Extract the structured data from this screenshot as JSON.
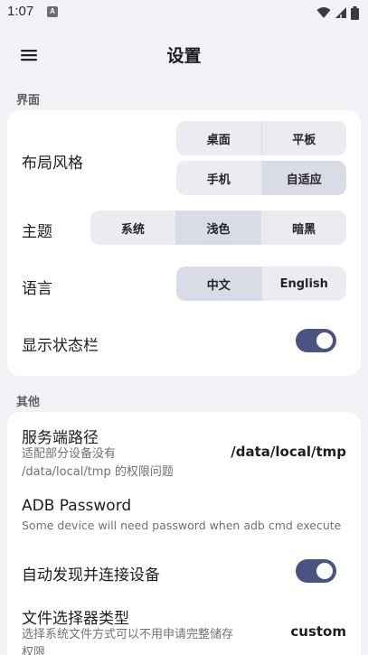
{
  "status_bar": {
    "time": "1:07",
    "notification_badge": "A",
    "icons": [
      "wifi-icon",
      "signal-icon",
      "battery-icon"
    ]
  },
  "app_bar": {
    "title": "设置",
    "menu_icon": "hamburger-menu-icon"
  },
  "sections": {
    "interface_label": "界面",
    "other_label": "其他"
  },
  "interface": {
    "layout": {
      "label": "布局风格",
      "options": [
        "桌面",
        "平板",
        "手机",
        "自适应"
      ],
      "selected": "自适应"
    },
    "theme": {
      "label": "主题",
      "options": [
        "系统",
        "浅色",
        "暗黑"
      ],
      "selected": "浅色"
    },
    "language": {
      "label": "语言",
      "options": [
        "中文",
        "English"
      ],
      "selected": "中文"
    },
    "status_bar_toggle": {
      "label": "显示状态栏",
      "on": true
    }
  },
  "other": {
    "server_path": {
      "title": "服务端路径",
      "subtitle_line1": "适配部分设备没有",
      "subtitle_line2": "/data/local/tmp 的权限问题",
      "value": "/data/local/tmp"
    },
    "adb_password": {
      "title": "ADB Password",
      "subtitle": "Some device will need password when adb cmd execute"
    },
    "auto_connect": {
      "title": "自动发现并连接设备",
      "on": true
    },
    "file_picker": {
      "title": "文件选择器类型",
      "subtitle_line1": "选择系统文件方式可以不用申请完整储存",
      "subtitle_line2": "权限",
      "value": "custom"
    }
  },
  "colors": {
    "background": "#f1f2f6",
    "card": "#ffffff",
    "accent_toggle": "#4c5282",
    "segment_selected": "#d9dbe6"
  }
}
